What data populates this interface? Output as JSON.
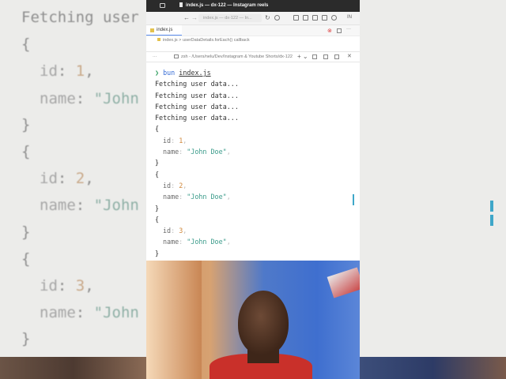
{
  "window": {
    "title": "index.js — dx-122 — Instagram reels",
    "command_center": "index.js — dx-122 — In...",
    "account_label": "IN"
  },
  "editor": {
    "tab_label": "index.js",
    "breadcrumb": {
      "file": "index.js",
      "symbol": "userDataDetails.forEach() callback"
    }
  },
  "terminal": {
    "shell_label": "zsh - /Users/nelu/Dev/Instagram & Youtube Shorts/dx-122",
    "prompt_symbol": "❯",
    "command": "bun",
    "command_arg": "index.js",
    "output": [
      "Fetching user data...",
      "Fetching user data...",
      "Fetching user data...",
      "Fetching user data..."
    ],
    "users": [
      {
        "id": "1",
        "name": "\"John Doe\""
      },
      {
        "id": "2",
        "name": "\"John Doe\""
      },
      {
        "id": "3",
        "name": "\"John Doe\""
      }
    ],
    "punct": {
      "open": "{",
      "close": "}",
      "id_key": "id",
      "name_key": "name",
      "colon": ":",
      "comma": ","
    }
  },
  "background": {
    "heading": "Fetching user",
    "users": [
      {
        "id": "1",
        "name": "\"John"
      },
      {
        "id": "2",
        "name": "\"John"
      },
      {
        "id": "3",
        "name": "\"John"
      }
    ]
  },
  "colors": {
    "prompt": "#2f9e5f",
    "keyword": "#3a6fd6",
    "number": "#d0883a",
    "string": "#3a9b8a",
    "accent": "#3fa7c9"
  }
}
